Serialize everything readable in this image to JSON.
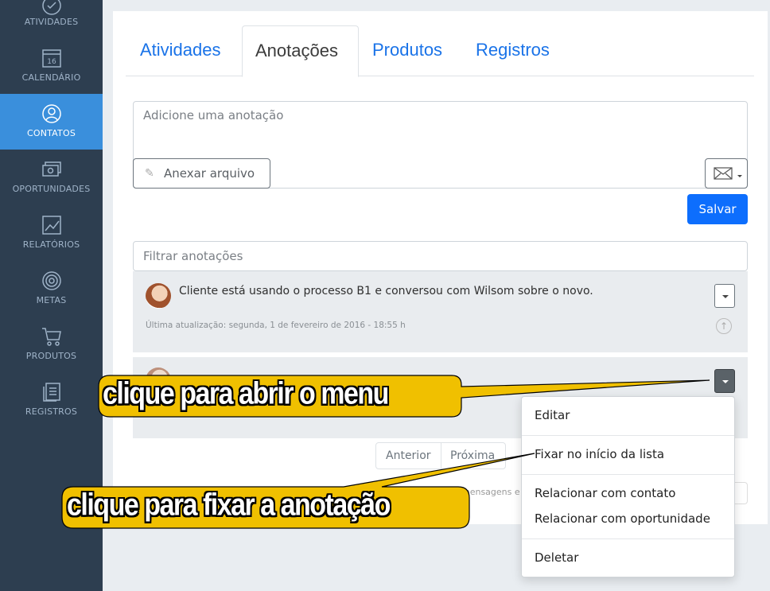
{
  "sidebar": {
    "items": [
      {
        "label": "ATIVIDADES",
        "icon": "check-circle-icon"
      },
      {
        "label": "CALENDÁRIO",
        "icon": "calendar-icon",
        "day": "16"
      },
      {
        "label": "CONTATOS",
        "icon": "person-icon",
        "active": true
      },
      {
        "label": "OPORTUNIDADES",
        "icon": "money-icon"
      },
      {
        "label": "RELATÓRIOS",
        "icon": "chart-icon"
      },
      {
        "label": "METAS",
        "icon": "target-icon"
      },
      {
        "label": "PRODUTOS",
        "icon": "cart-icon"
      },
      {
        "label": "REGISTROS",
        "icon": "document-icon"
      }
    ]
  },
  "tabs": [
    "Atividades",
    "Anotações",
    "Produtos",
    "Registros"
  ],
  "active_tab": "Anotações",
  "composer": {
    "placeholder": "Adicione uma anotação",
    "attach_label": "Anexar arquivo",
    "save_label": "Salvar"
  },
  "filter": {
    "placeholder": "Filtrar anotações"
  },
  "notes": [
    {
      "text": "Cliente está usando o processo B1 e conversou com Wilsom sobre o novo.",
      "meta": "Última atualização: segunda, 1 de fevereiro de 2016 - 18:55 h"
    }
  ],
  "pager": {
    "prev": "Anterior",
    "next": "Próxima"
  },
  "footer_fragment": "mensagens e",
  "menu": {
    "items": [
      "Editar",
      "Fixar no início da lista",
      "Relacionar com contato",
      "Relacionar com oportunidade",
      "Deletar"
    ]
  },
  "callouts": {
    "open_menu": "clique para abrir o menu",
    "pin_note": "clique para fixar a anotação"
  },
  "colors": {
    "sidebar": "#2d3e50",
    "active": "#3a8fdc",
    "primary": "#0d6efd",
    "callout": "#f0c000"
  }
}
